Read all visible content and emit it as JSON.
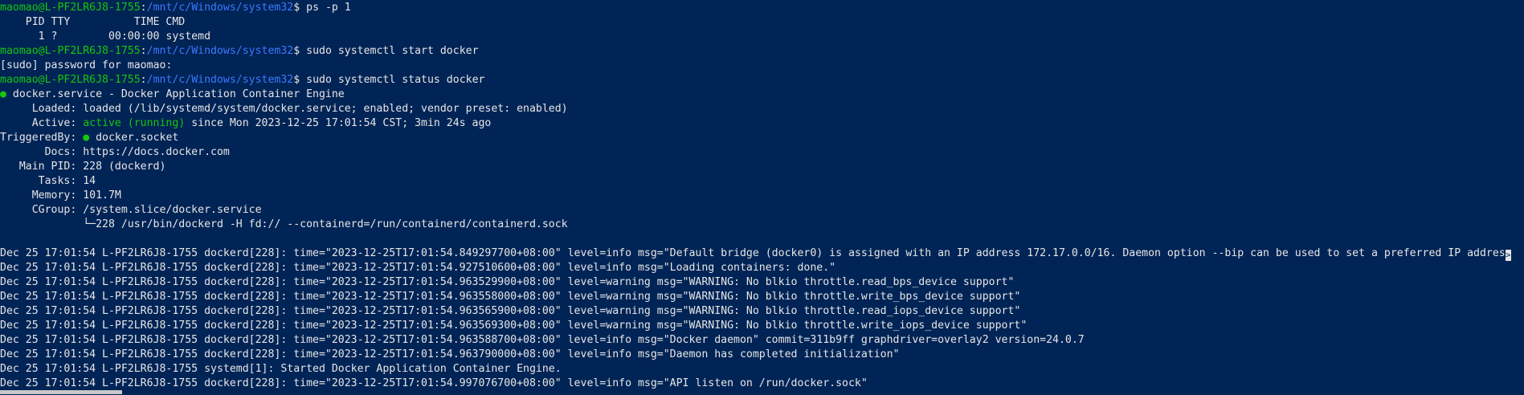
{
  "prompt": {
    "user_host": "maomao@L-PF2LR6J8-1755",
    "path": "/mnt/c/Windows/system32",
    "symbol": "$ "
  },
  "lines": [
    {
      "type": "prompt",
      "cmd": "ps -p 1"
    },
    {
      "type": "text",
      "text": "    PID TTY          TIME CMD"
    },
    {
      "type": "text",
      "text": "      1 ?        00:00:00 systemd"
    },
    {
      "type": "prompt",
      "cmd": "sudo systemctl start docker"
    },
    {
      "type": "text",
      "text": "[sudo] password for maomao:"
    },
    {
      "type": "prompt",
      "cmd": "sudo systemctl status docker"
    },
    {
      "type": "rich",
      "parts": [
        {
          "t": "● ",
          "c": "green"
        },
        {
          "t": "docker.service - Docker Application Container Engine"
        }
      ]
    },
    {
      "type": "text",
      "text": "     Loaded: loaded (/lib/systemd/system/docker.service; enabled; vendor preset: enabled)"
    },
    {
      "type": "rich",
      "parts": [
        {
          "t": "     Active: "
        },
        {
          "t": "active (running)",
          "c": "green"
        },
        {
          "t": " since Mon 2023-12-25 17:01:54 CST; 3min 24s ago"
        }
      ]
    },
    {
      "type": "rich",
      "parts": [
        {
          "t": "TriggeredBy: "
        },
        {
          "t": "●",
          "c": "green"
        },
        {
          "t": " docker.socket"
        }
      ]
    },
    {
      "type": "text",
      "text": "       Docs: https://docs.docker.com"
    },
    {
      "type": "text",
      "text": "   Main PID: 228 (dockerd)"
    },
    {
      "type": "text",
      "text": "      Tasks: 14"
    },
    {
      "type": "text",
      "text": "     Memory: 101.7M"
    },
    {
      "type": "text",
      "text": "     CGroup: /system.slice/docker.service"
    },
    {
      "type": "text",
      "text": "             └─228 /usr/bin/dockerd -H fd:// --containerd=/run/containerd/containerd.sock"
    },
    {
      "type": "text",
      "text": ""
    },
    {
      "type": "text",
      "text": "Dec 25 17:01:54 L-PF2LR6J8-1755 dockerd[228]: time=\"2023-12-25T17:01:54.849297700+08:00\" level=info msg=\"Default bridge (docker0) is assigned with an IP address 172.17.0.0/16. Daemon option --bip can be used to set a preferred IP addres",
      "trunc": ">"
    },
    {
      "type": "text",
      "text": "Dec 25 17:01:54 L-PF2LR6J8-1755 dockerd[228]: time=\"2023-12-25T17:01:54.927510600+08:00\" level=info msg=\"Loading containers: done.\""
    },
    {
      "type": "text",
      "text": "Dec 25 17:01:54 L-PF2LR6J8-1755 dockerd[228]: time=\"2023-12-25T17:01:54.963529900+08:00\" level=warning msg=\"WARNING: No blkio throttle.read_bps_device support\""
    },
    {
      "type": "text",
      "text": "Dec 25 17:01:54 L-PF2LR6J8-1755 dockerd[228]: time=\"2023-12-25T17:01:54.963558000+08:00\" level=warning msg=\"WARNING: No blkio throttle.write_bps_device support\""
    },
    {
      "type": "text",
      "text": "Dec 25 17:01:54 L-PF2LR6J8-1755 dockerd[228]: time=\"2023-12-25T17:01:54.963565900+08:00\" level=warning msg=\"WARNING: No blkio throttle.read_iops_device support\""
    },
    {
      "type": "text",
      "text": "Dec 25 17:01:54 L-PF2LR6J8-1755 dockerd[228]: time=\"2023-12-25T17:01:54.963569300+08:00\" level=warning msg=\"WARNING: No blkio throttle.write_iops_device support\""
    },
    {
      "type": "text",
      "text": "Dec 25 17:01:54 L-PF2LR6J8-1755 dockerd[228]: time=\"2023-12-25T17:01:54.963588700+08:00\" level=info msg=\"Docker daemon\" commit=311b9ff graphdriver=overlay2 version=24.0.7"
    },
    {
      "type": "text",
      "text": "Dec 25 17:01:54 L-PF2LR6J8-1755 dockerd[228]: time=\"2023-12-25T17:01:54.963790000+08:00\" level=info msg=\"Daemon has completed initialization\""
    },
    {
      "type": "text",
      "text": "Dec 25 17:01:54 L-PF2LR6J8-1755 systemd[1]: Started Docker Application Container Engine."
    },
    {
      "type": "text",
      "text": "Dec 25 17:01:54 L-PF2LR6J8-1755 dockerd[228]: time=\"2023-12-25T17:01:54.997076700+08:00\" level=info msg=\"API listen on /run/docker.sock\""
    }
  ],
  "colors": {
    "background": "#012456",
    "foreground": "#e6e6e6",
    "user": "#16c60c",
    "path": "#3b78ff"
  }
}
